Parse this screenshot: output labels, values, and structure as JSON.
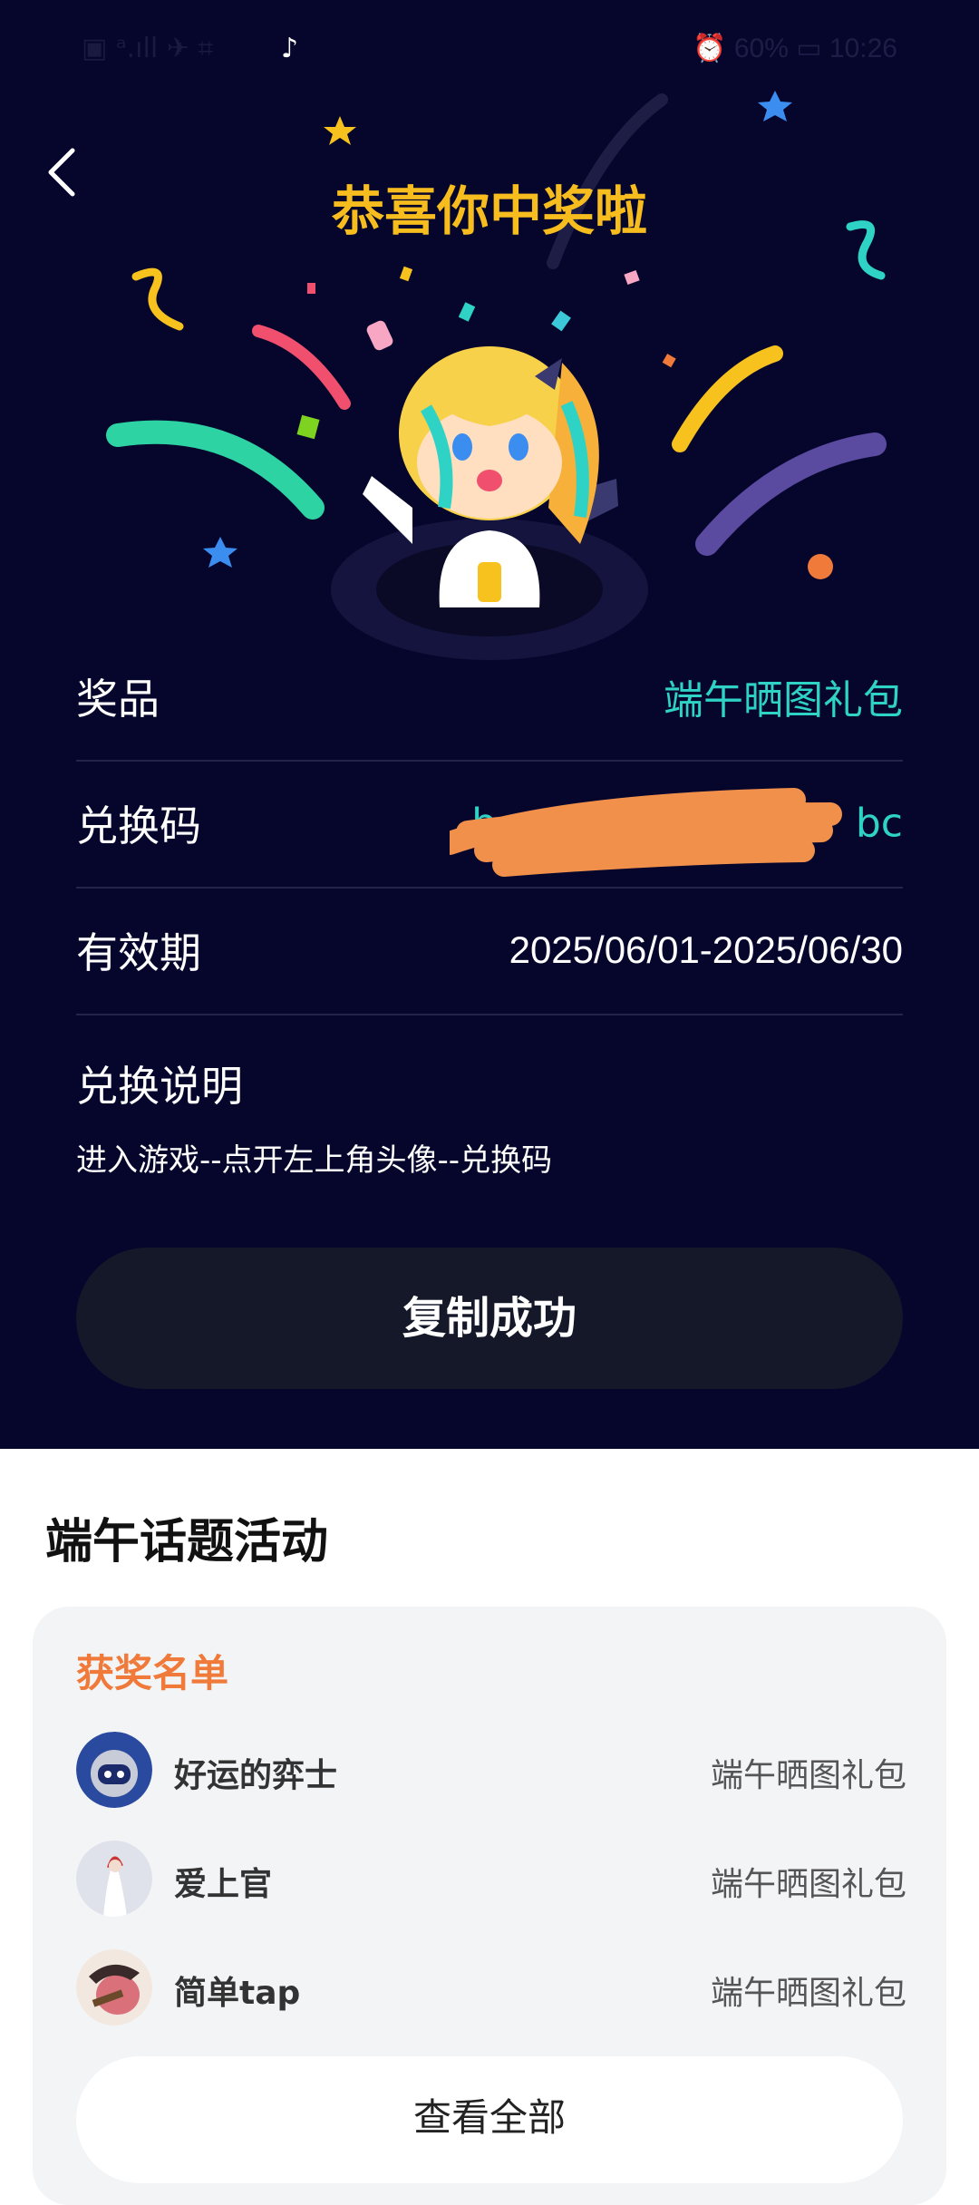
{
  "status_bar": {
    "left": "▣ ᵃ.ıll ✈ ⌗",
    "tiktok_icon": "♪",
    "right": "⏰ 60% ▭ 10:26"
  },
  "header": {
    "back_icon": "chevron-left-icon",
    "title": "恭喜你中奖啦"
  },
  "prize_info": {
    "prize_label": "奖品",
    "prize_value": "端午晒图礼包",
    "code_label": "兑换码",
    "code_value_visible_start": "b",
    "code_value_visible_end": "bc",
    "validity_label": "有效期",
    "validity_value": "2025/06/01-2025/06/30"
  },
  "explanation": {
    "title": "兑换说明",
    "text": "进入游戏--点开左上角头像--兑换码"
  },
  "copy_button": {
    "label": "复制成功"
  },
  "activity": {
    "title": "端午话题活动",
    "winners_title": "获奖名单",
    "winners": [
      {
        "name": "好运的弈士",
        "prize": "端午晒图礼包"
      },
      {
        "name": "爱上官",
        "prize": "端午晒图礼包"
      },
      {
        "name": "简单tap",
        "prize": "端午晒图礼包"
      }
    ],
    "view_all_label": "查看全部"
  },
  "colors": {
    "hero_bg": "#06062d",
    "title": "#f7bd1e",
    "teal_value": "#2ed3c6",
    "winners_title": "#f07a3a",
    "copy_button_bg": "#141829",
    "redaction": "#f0904a"
  }
}
